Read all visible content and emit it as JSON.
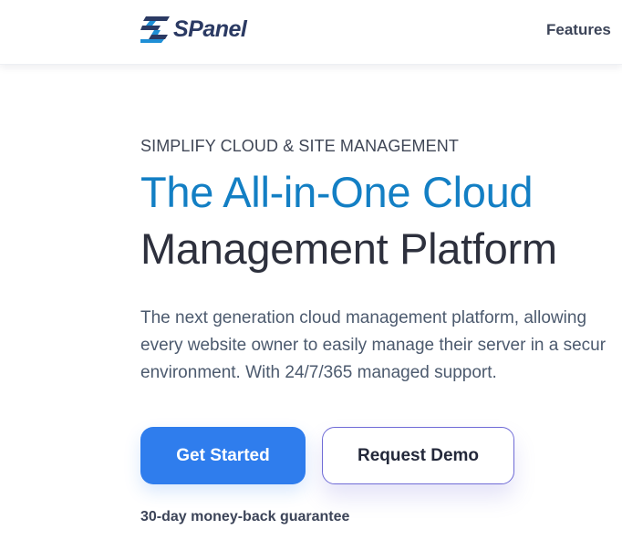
{
  "header": {
    "logo_text": "SPanel",
    "logo_icon": "spanel-logo-icon",
    "nav": {
      "features_label": "Features"
    }
  },
  "hero": {
    "eyebrow": "SIMPLIFY CLOUD & SITE MANAGEMENT",
    "title_line1": "The All-in-One Cloud",
    "title_line2": "Management Platform",
    "description_lines": [
      "The next generation cloud management platform, allowing",
      "every website owner to easily manage their server in a secur",
      "environment. With 24/7/365 managed support."
    ],
    "primary_button": "Get Started",
    "secondary_button": "Request Demo",
    "guarantee": "30-day money-back guarantee"
  },
  "colors": {
    "accent_blue": "#137fc4",
    "button_blue": "#2f7ded",
    "heading_dark": "#2d303d",
    "logo_navy": "#2b3a63",
    "demo_border": "#6f6bd6"
  }
}
